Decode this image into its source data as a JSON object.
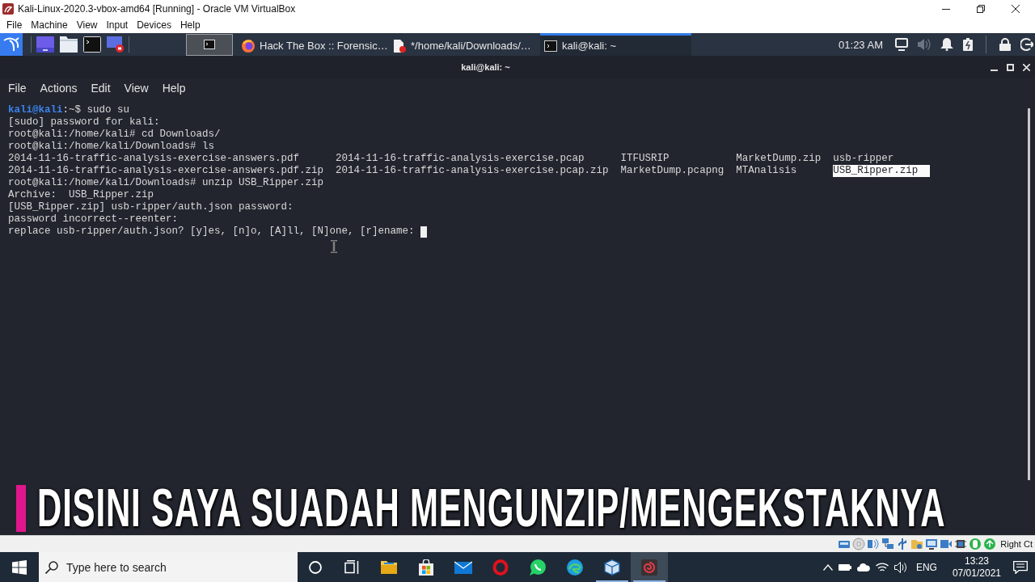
{
  "vbox": {
    "title": "Kali-Linux-2020.3-vbox-amd64 [Running] - Oracle VM VirtualBox",
    "menu": [
      "File",
      "Machine",
      "View",
      "Input",
      "Devices",
      "Help"
    ]
  },
  "kali_panel": {
    "tasks": [
      {
        "kind": "browser",
        "label": "Hack The Box :: Forensic…",
        "selected": false
      },
      {
        "kind": "editor",
        "label": "*/home/kali/Downloads/…",
        "selected": false
      },
      {
        "kind": "terminal",
        "label": "kali@kali: ~",
        "selected": true
      }
    ],
    "clock": "01:23 AM"
  },
  "terminal": {
    "title": "kali@kali: ~",
    "menu": [
      "File",
      "Actions",
      "Edit",
      "View",
      "Help"
    ],
    "lines": [
      {
        "kind": "user_prompt",
        "user": "kali@kali",
        "text": ":~$ sudo su"
      },
      {
        "kind": "text",
        "text": "[sudo] password for kali:"
      },
      {
        "kind": "text",
        "text": "root@kali:/home/kali# cd Downloads/"
      },
      {
        "kind": "text",
        "text": "root@kali:/home/kali/Downloads# ls"
      },
      {
        "kind": "listing",
        "rows": [
          [
            {
              "name": "2014-11-16-traffic-analysis-exercise-answers.pdf",
              "selected": false
            },
            {
              "name": "2014-11-16-traffic-analysis-exercise.pcap",
              "selected": false
            },
            {
              "name": "ITFUSRIP",
              "selected": false
            },
            {
              "name": "MarketDump.zip",
              "selected": false
            },
            {
              "name": "usb-ripper",
              "selected": false
            }
          ],
          [
            {
              "name": "2014-11-16-traffic-analysis-exercise-answers.pdf.zip",
              "selected": false
            },
            {
              "name": "2014-11-16-traffic-analysis-exercise.pcap.zip",
              "selected": false
            },
            {
              "name": "MarketDump.pcapng",
              "selected": false
            },
            {
              "name": "MTAnalisis",
              "selected": false
            },
            {
              "name": "USB_Ripper.zip",
              "selected": true
            }
          ]
        ]
      },
      {
        "kind": "text",
        "text": "root@kali:/home/kali/Downloads# unzip USB_Ripper.zip"
      },
      {
        "kind": "text",
        "text": "Archive:  USB_Ripper.zip"
      },
      {
        "kind": "text",
        "text": "[USB_Ripper.zip] usb-ripper/auth.json password:"
      },
      {
        "kind": "text",
        "text": "password incorrect--reenter:"
      },
      {
        "kind": "input_prompt",
        "text": "replace usb-ripper/auth.json? [y]es, [n]o, [A]ll, [N]one, [r]ename:"
      }
    ]
  },
  "caption": "DISINI SAYA SUADAH MENGUNZIP/MENGEKSTAKNYA",
  "vbox_status": {
    "host_key": "Right Ct"
  },
  "taskbar": {
    "search": {
      "placeholder": "Type here to search"
    },
    "apps": [
      {
        "kind": "explorer",
        "running": false,
        "selected": false
      },
      {
        "kind": "store",
        "running": false,
        "selected": false
      },
      {
        "kind": "mail",
        "running": false,
        "selected": false
      },
      {
        "kind": "opera",
        "running": false,
        "selected": false
      },
      {
        "kind": "whatsapp",
        "running": false,
        "selected": false
      },
      {
        "kind": "edge",
        "running": false,
        "selected": false
      },
      {
        "kind": "virtualbox",
        "running": true,
        "selected": false
      },
      {
        "kind": "vm_window",
        "running": true,
        "selected": true
      }
    ],
    "language": "ENG",
    "time": "13:23",
    "date": "07/01/2021"
  }
}
